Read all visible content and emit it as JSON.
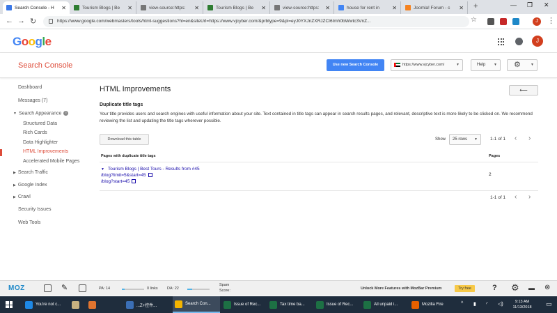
{
  "browser": {
    "tabs": [
      {
        "title": "Search Console - H",
        "favicon_color": "#3b78e7",
        "active": true
      },
      {
        "title": "Tourism Blogs | Be",
        "favicon_color": "#2e7d32",
        "active": false
      },
      {
        "title": "view-source:https:",
        "favicon_color": "#777777",
        "active": false
      },
      {
        "title": "Tourism Blogs | Be",
        "favicon_color": "#2e7d32",
        "active": false
      },
      {
        "title": "view-source:https:",
        "favicon_color": "#777777",
        "active": false
      },
      {
        "title": "house for rent in",
        "favicon_color": "#4285f4",
        "active": false
      },
      {
        "title": "Joomla! Forum - c",
        "favicon_color": "#f5821f",
        "active": false
      }
    ],
    "new_tab": "+",
    "url": "https://www.google.com/webmasters/tools/html-suggestions?hl=en&siteUrl=https://www.vjcyber.com/&prbtype=9&pl=eyJ0YXJnZXRJZCI6Imh0bWwtc3VnZ...",
    "profile_initial": "J"
  },
  "google_header": {
    "logo_letters": [
      {
        "ch": "G",
        "color": "#4285f4"
      },
      {
        "ch": "o",
        "color": "#ea4335"
      },
      {
        "ch": "o",
        "color": "#fbbc05"
      },
      {
        "ch": "g",
        "color": "#4285f4"
      },
      {
        "ch": "l",
        "color": "#34a853"
      },
      {
        "ch": "e",
        "color": "#ea4335"
      }
    ],
    "avatar_initial": "J"
  },
  "sc_bar": {
    "title": "Search Console",
    "new_console_button": "Use new Search Console",
    "site": "https://www.vjcyber.com/",
    "help": "Help"
  },
  "sidebar": {
    "items": [
      {
        "label": "Dashboard"
      },
      {
        "label": "Messages (7)"
      },
      {
        "label": "Search Appearance"
      },
      {
        "label": "Structured Data"
      },
      {
        "label": "Rich Cards"
      },
      {
        "label": "Data Highlighter"
      },
      {
        "label": "HTML Improvements"
      },
      {
        "label": "Accelerated Mobile Pages"
      },
      {
        "label": "Search Traffic"
      },
      {
        "label": "Google Index"
      },
      {
        "label": "Crawl"
      },
      {
        "label": "Security Issues"
      },
      {
        "label": "Web Tools"
      }
    ]
  },
  "main": {
    "page_title": "HTML Improvements",
    "back_glyph": "⟵",
    "section_title": "Duplicate title tags",
    "description": "Your title provides users and search engines with useful information about your site. Text contained in title tags can appear in search results pages, and relevant, descriptive text is more likely to be clicked on. We recommend reviewing the list and updating the title tags wherever possible.",
    "download_button": "Download this table",
    "show_label": "Show",
    "rows_select": "25 rows",
    "page_info_top": "1-1 of 1",
    "page_info_bottom": "1-1 of 1",
    "table": {
      "col_pages_with": "Pages with duplicate title tags",
      "col_pages": "Pages",
      "rows": [
        {
          "title": "Tourism Blogs | Best Tours - Results from #45",
          "urls": [
            "/blog?limit=5&start=45",
            "/blog?start=45"
          ],
          "pages": "2"
        }
      ]
    }
  },
  "moz_bar": {
    "logo": "MOZ",
    "pa": "PA: 14",
    "links": "0 links",
    "da": "DA: 22",
    "spam_line1": "Spam",
    "spam_line2": "Score:",
    "promo": "Unlock More Features with MozBar Premium",
    "try_free": "Try free",
    "help": "?",
    "pa_fill": 0.14,
    "da_fill": 0.22
  },
  "taskbar": {
    "items": [
      {
        "label": "You're not c...",
        "icon_color": "#1e88e5",
        "active": false
      },
      {
        "label": "",
        "icon_color": "#c8b280",
        "active": false
      },
      {
        "label": "",
        "icon_color": "#e0742f",
        "active": false
      },
      {
        "label": "...Z+控件...",
        "icon_color": "#3b6fb6",
        "active": false
      },
      {
        "label": "Search Con...",
        "icon_color": "#f4b400",
        "active": true
      },
      {
        "label": "Issue of Rec...",
        "icon_color": "#1d7044",
        "active": false
      },
      {
        "label": "Tax time ba...",
        "icon_color": "#1d7044",
        "active": false
      },
      {
        "label": "Issue of Rec...",
        "icon_color": "#1d7044",
        "active": false
      },
      {
        "label": "All unpaid i...",
        "icon_color": "#1d7044",
        "active": false
      },
      {
        "label": "Mozilla Fire",
        "icon_color": "#e66000",
        "active": false
      }
    ],
    "time": "9:13 AM",
    "date": "11/13/2018"
  }
}
